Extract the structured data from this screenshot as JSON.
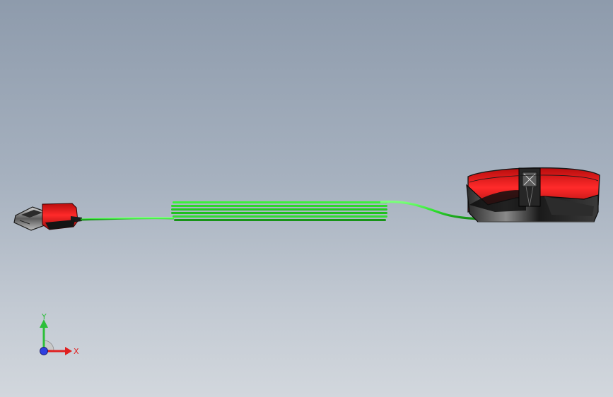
{
  "window": {
    "background_top": "#8e9bac",
    "background_bottom": "#d2d7dd"
  },
  "model": {
    "parts": [
      {
        "name": "usb-connector",
        "icon": "usb-plug-icon"
      },
      {
        "name": "coiled-cable",
        "icon": "cable-coil-icon"
      },
      {
        "name": "mouse-body",
        "icon": "mouse-icon"
      }
    ],
    "colors": {
      "cable": "#2ee62e",
      "shell_red": "#e01818",
      "body_dark": "#1c1c1c"
    }
  },
  "triad": {
    "y_label": "Y",
    "x_label": "X",
    "colors": {
      "y": "#2dbf3a",
      "x": "#e02020",
      "z": "#2f3fe0"
    }
  }
}
